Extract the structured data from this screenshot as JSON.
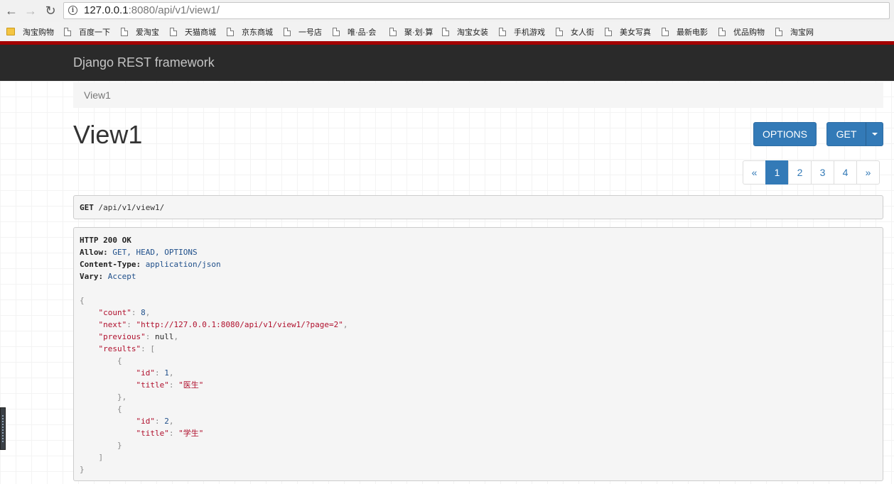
{
  "browser": {
    "url_host": "127.0.0.1",
    "url_rest": ":8080/api/v1/view1/",
    "bookmarks": [
      {
        "label": "淘宝购物",
        "type": "folder"
      },
      {
        "label": "百度一下",
        "type": "page"
      },
      {
        "label": "爱淘宝",
        "type": "page"
      },
      {
        "label": "天猫商城",
        "type": "page"
      },
      {
        "label": "京东商城",
        "type": "page"
      },
      {
        "label": "一号店",
        "type": "page"
      },
      {
        "label": "唯·品·会",
        "type": "page"
      },
      {
        "label": "聚·划·算",
        "type": "page"
      },
      {
        "label": "淘宝女装",
        "type": "page"
      },
      {
        "label": "手机游戏",
        "type": "page"
      },
      {
        "label": "女人街",
        "type": "page"
      },
      {
        "label": "美女写真",
        "type": "page"
      },
      {
        "label": "最新电影",
        "type": "page"
      },
      {
        "label": "优品购物",
        "type": "page"
      },
      {
        "label": "淘宝网",
        "type": "page"
      }
    ]
  },
  "navbar": {
    "brand": "Django REST framework"
  },
  "breadcrumb": {
    "item": "View1"
  },
  "page": {
    "title": "View1"
  },
  "buttons": {
    "options": "OPTIONS",
    "get": "GET"
  },
  "pagination": {
    "prev": "«",
    "pages": [
      "1",
      "2",
      "3",
      "4"
    ],
    "active": "1",
    "next": "»"
  },
  "request": {
    "method": "GET",
    "path": " /api/v1/view1/"
  },
  "response": {
    "status": "HTTP 200 OK",
    "headers": [
      {
        "key": "Allow:",
        "value": " GET, HEAD, OPTIONS"
      },
      {
        "key": "Content-Type:",
        "value": " application/json"
      },
      {
        "key": "Vary:",
        "value": " Accept"
      }
    ],
    "body": {
      "count_key": "\"count\"",
      "count_val": "8",
      "next_key": "\"next\"",
      "next_val": "\"http://127.0.0.1:8080/api/v1/view1/?page=2\"",
      "previous_key": "\"previous\"",
      "previous_val": "null",
      "results_key": "\"results\"",
      "items": [
        {
          "id_key": "\"id\"",
          "id_val": "1",
          "title_key": "\"title\"",
          "title_val": "\"医生\""
        },
        {
          "id_key": "\"id\"",
          "id_val": "2",
          "title_key": "\"title\"",
          "title_val": "\"学生\""
        }
      ]
    }
  }
}
